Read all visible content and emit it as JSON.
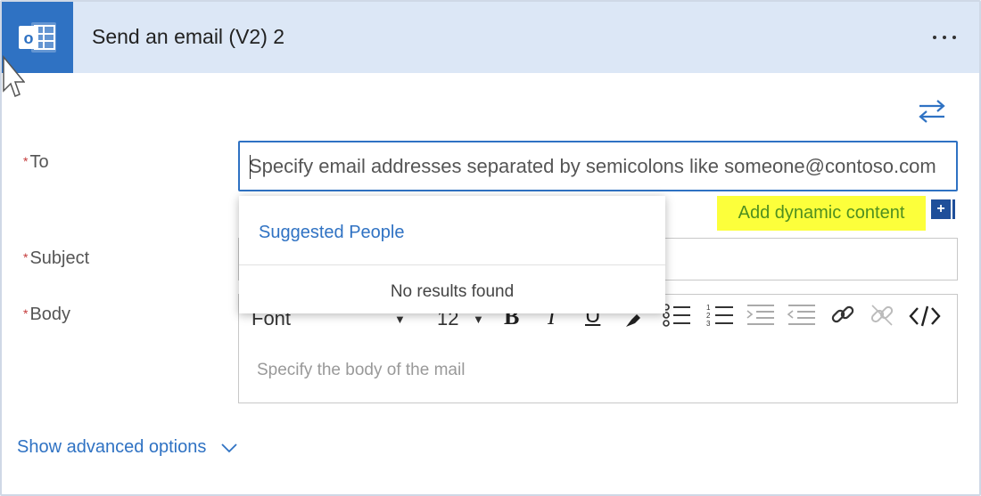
{
  "card": {
    "title": "Send an email (V2) 2",
    "connector_icon": "outlook-icon",
    "menu_icon": "more-options-icon"
  },
  "fields": {
    "to": {
      "required_mark": "*",
      "label": "To",
      "placeholder": "Specify email addresses separated by semicolons like someone@contoso.com",
      "value": ""
    },
    "subject": {
      "required_mark": "*",
      "label": "Subject",
      "value": ""
    },
    "body": {
      "required_mark": "*",
      "label": "Body",
      "placeholder": "Specify the body of the mail"
    }
  },
  "dynamic_content": {
    "label": "Add dynamic content",
    "plus": "+",
    "highlight_color": "#fcff3b"
  },
  "toolbar": {
    "font_label": "Font",
    "size_label": "12",
    "bold": "B",
    "italic": "I",
    "underline": "U",
    "icons": [
      "text-color-icon",
      "bulleted-list-icon",
      "numbered-list-icon",
      "decrease-indent-icon",
      "increase-indent-icon",
      "link-icon",
      "unlink-icon",
      "code-view-icon"
    ]
  },
  "suggestions": {
    "header": "Suggested People",
    "empty_text": "No results found"
  },
  "advanced": {
    "label": "Show advanced options"
  },
  "colors": {
    "accent": "#2f72c3",
    "header_bg": "#dce7f6",
    "required": "#c43a3a"
  }
}
